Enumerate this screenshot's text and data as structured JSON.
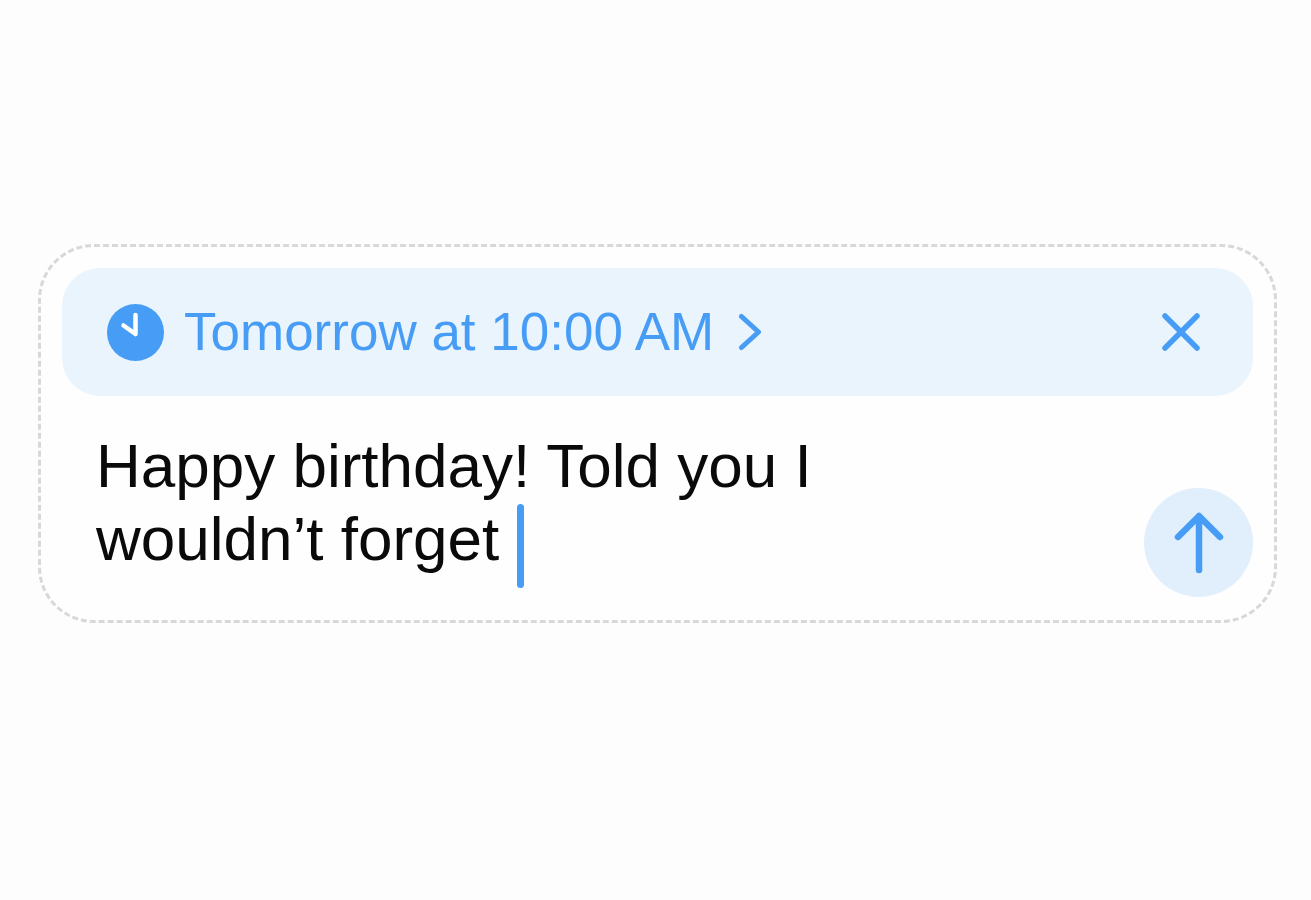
{
  "schedule_banner": {
    "label": "Tomorrow at 10:00 AM"
  },
  "message": {
    "value": "Happy birthday! Told you I wouldn’t forget",
    "focused": true
  }
}
